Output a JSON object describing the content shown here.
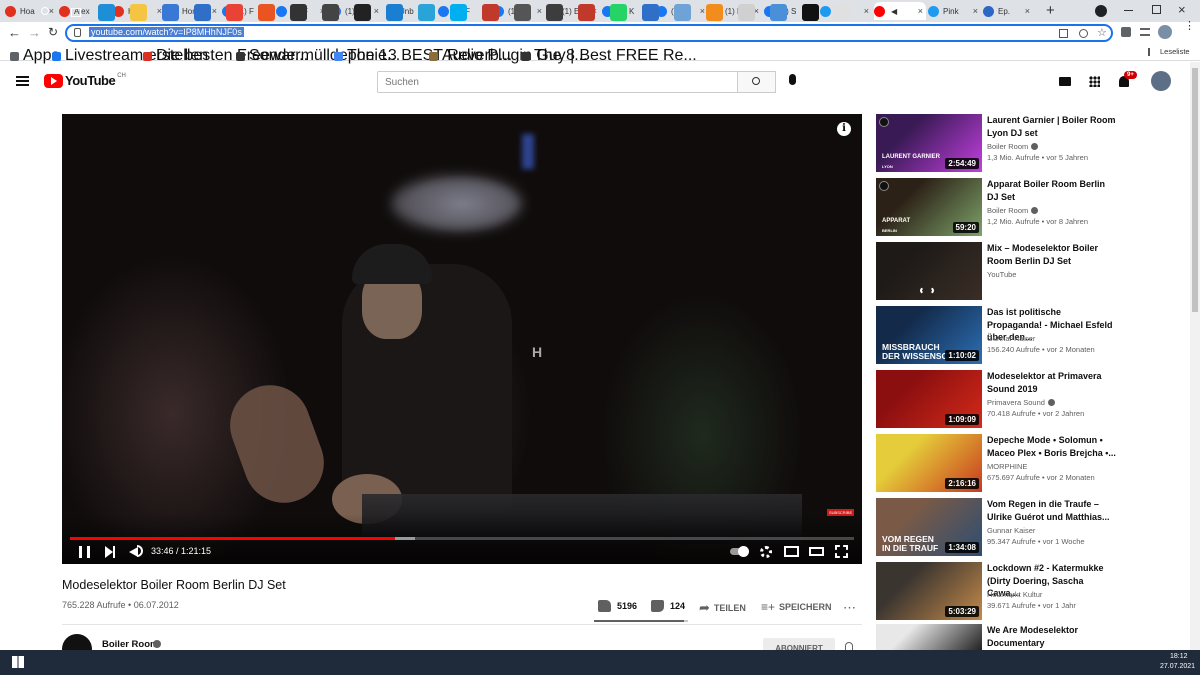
{
  "browser": {
    "tabs": [
      {
        "label": "Hoa",
        "icon": "opera-icon",
        "color": "#e0301e"
      },
      {
        "label": "Alex",
        "icon": "opera-icon",
        "color": "#e0301e"
      },
      {
        "label": "Hoa",
        "icon": "opera-icon",
        "color": "#e0301e"
      },
      {
        "label": "Hon",
        "icon": "twitter-icon",
        "color": "#1d9bf0"
      },
      {
        "label": "(1) F",
        "icon": "facebook-icon",
        "color": "#1877f2"
      },
      {
        "label": "(1) F",
        "icon": "facebook-icon",
        "color": "#1877f2"
      },
      {
        "label": "(1) F",
        "icon": "facebook-icon",
        "color": "#1877f2"
      },
      {
        "label": "Unb",
        "icon": "blank-icon",
        "color": "#dee1e6"
      },
      {
        "label": "(1) F",
        "icon": "facebook-icon",
        "color": "#1877f2"
      },
      {
        "label": "(1) n",
        "icon": "facebook-icon",
        "color": "#1877f2"
      },
      {
        "label": "(1) E",
        "icon": "facebook-icon",
        "color": "#1877f2"
      },
      {
        "label": "(1) K",
        "icon": "facebook-icon",
        "color": "#1877f2"
      },
      {
        "label": "(1) a",
        "icon": "facebook-icon",
        "color": "#1877f2"
      },
      {
        "label": "(1) F",
        "icon": "facebook-icon",
        "color": "#1877f2"
      },
      {
        "label": "(1) S",
        "icon": "facebook-icon",
        "color": "#1877f2"
      },
      {
        "label": "Hon",
        "icon": "twitter-icon",
        "color": "#1d9bf0"
      },
      {
        "label": "",
        "icon": "youtube-icon",
        "color": "#ff0000"
      },
      {
        "label": "Pink",
        "icon": "twitter-icon",
        "color": "#1d9bf0"
      },
      {
        "label": "Ep.",
        "icon": "s-icon",
        "color": "#2d66c3"
      }
    ],
    "url": "youtube.com/watch?v=IP8MHhNJF0s",
    "reading_list": "Leseliste",
    "bookmarks": [
      {
        "label": "Apps",
        "color": "#5f6368"
      },
      {
        "label": "Livestream erstellen",
        "color": "#1877f2"
      },
      {
        "label": "Die besten Freewar...",
        "color": "#d93025"
      },
      {
        "label": "Sondermülldeponie...",
        "color": "#333333"
      },
      {
        "label": "The 13 BEST Reverb...",
        "color": "#4285f4"
      },
      {
        "label": "Audio Plugin Guy |...",
        "color": "#8a6d3b"
      },
      {
        "label": "The 8 Best FREE Re...",
        "color": "#333333"
      }
    ]
  },
  "youtube": {
    "logo_text": "YouTube",
    "region": "CH",
    "search_placeholder": "Suchen",
    "notification_count": "9+",
    "player": {
      "current_time": "33:46 / 1:21:15",
      "progress": 0.415,
      "buffered": 0.44,
      "badge": "SUBSCRIBE",
      "overlay_letter": "H"
    },
    "video": {
      "title": "Modeselektor Boiler Room Berlin DJ Set",
      "views_date": "765.228 Aufrufe • 06.07.2012",
      "likes": "5196",
      "dislikes": "124",
      "share": "TEILEN",
      "save": "SPEICHERN",
      "channel": "Boiler Room",
      "subscribe": "ABONNIERT"
    },
    "suggestions": [
      {
        "title": "Laurent Garnier | Boiler Room Lyon DJ set",
        "channel": "Boiler Room",
        "verified": true,
        "meta": "1,3 Mio. Aufrufe • vor 5 Jahren",
        "duration": "2:54:49",
        "thumb_text": "LAURENT GARNIER",
        "thumb_sub": "LYON",
        "thumb_bg": "#3a1a55",
        "thumb_accent": "#c23fe0"
      },
      {
        "title": "Apparat Boiler Room Berlin DJ Set",
        "channel": "Boiler Room",
        "verified": true,
        "meta": "1,2 Mio. Aufrufe • vor 8 Jahren",
        "duration": "59:20",
        "thumb_text": "APPARAT",
        "thumb_sub": "BERLIN",
        "thumb_bg": "#2c2116",
        "thumb_accent": "#7da36a"
      },
      {
        "title": "Mix – Modeselektor Boiler Room Berlin DJ Set",
        "channel": "YouTube",
        "verified": false,
        "meta": "",
        "duration": "",
        "thumb_text": "",
        "thumb_sub": "",
        "thumb_bg": "#1e1a18",
        "thumb_accent": "#3a2e26"
      },
      {
        "title": "Das ist politische Propaganda! - Michael Esfeld über den...",
        "channel": "Gunnar Kaiser",
        "verified": false,
        "meta": "156.240 Aufrufe • vor 2 Monaten",
        "duration": "1:10:02",
        "thumb_text": "MISSBRAUCH",
        "thumb_sub": "DER WISSENSC",
        "thumb_bg": "#132a4a",
        "thumb_accent": "#2c6fb5"
      },
      {
        "title": "Modeselektor at Primavera Sound 2019",
        "channel": "Primavera Sound",
        "verified": true,
        "meta": "70.418 Aufrufe • vor 2 Jahren",
        "duration": "1:09:09",
        "thumb_text": "",
        "thumb_sub": "",
        "thumb_bg": "#8c0f0f",
        "thumb_accent": "#d42a1a"
      },
      {
        "title": "Depeche Mode • Solomun • Maceo Plex • Boris Brejcha •...",
        "channel": "MORPHINE",
        "verified": false,
        "meta": "675.697 Aufrufe • vor 2 Monaten",
        "duration": "2:16:16",
        "thumb_text": "",
        "thumb_sub": "",
        "thumb_bg": "#e5cc3a",
        "thumb_accent": "#c83a1e"
      },
      {
        "title": "Vom Regen in die Traufe – Ulrike Guérot und Matthias...",
        "channel": "Gunnar Kaiser",
        "verified": false,
        "meta": "95.347 Aufrufe • vor 1 Woche",
        "duration": "1:34:08",
        "thumb_text": "VOM REGEN",
        "thumb_sub": "IN DIE TRAUF",
        "thumb_bg": "#7a5a46",
        "thumb_accent": "#2d4e73"
      },
      {
        "title": "Lockdown #2 - Katermukke (Dirty Doering, Sascha Cawa,...",
        "channel": "Holzmarkt Kultur",
        "verified": false,
        "meta": "39.671 Aufrufe • vor 1 Jahr",
        "duration": "5:03:29",
        "thumb_text": "",
        "thumb_sub": "",
        "thumb_bg": "#3b3530",
        "thumb_accent": "#c48a4a"
      },
      {
        "title": "We Are Modeselektor Documentary",
        "channel": "",
        "verified": false,
        "meta": "",
        "duration": "",
        "thumb_text": "",
        "thumb_sub": "",
        "thumb_bg": "#e8e8e8",
        "thumb_accent": "#222222"
      }
    ]
  },
  "taskbar": {
    "time": "18:12",
    "date": "27.07.2021",
    "apps": [
      {
        "name": "search-icon",
        "color": "#1f2a3a"
      },
      {
        "name": "task-view-icon",
        "color": "#1f2a3a"
      },
      {
        "name": "edge-icon",
        "color": "#1e8fd6"
      },
      {
        "name": "file-explorer-icon",
        "color": "#f4c542"
      },
      {
        "name": "store-icon",
        "color": "#3a78d6"
      },
      {
        "name": "mail-icon",
        "color": "#2f6fc8"
      },
      {
        "name": "chrome-icon",
        "color": "#e94335"
      },
      {
        "name": "ubuntu-icon",
        "color": "#e95420"
      },
      {
        "name": "app-icon",
        "color": "#333333"
      },
      {
        "name": "inkscape-icon",
        "color": "#444444"
      },
      {
        "name": "ableton-live-icon",
        "color": "#222222"
      },
      {
        "name": "cloud-app-icon",
        "color": "#1a7fd0"
      },
      {
        "name": "telegram-icon",
        "color": "#2aa3d8"
      },
      {
        "name": "skype-icon",
        "color": "#00aff0"
      },
      {
        "name": "media-app-icon",
        "color": "#c0392b"
      },
      {
        "name": "keyboard-icon",
        "color": "#555555"
      },
      {
        "name": "tool-icon",
        "color": "#3d3d3d"
      },
      {
        "name": "cubase-icon",
        "color": "#c0392b"
      },
      {
        "name": "whatsapp-icon",
        "color": "#25d366"
      },
      {
        "name": "app-blue-icon",
        "color": "#2f6fc8"
      },
      {
        "name": "editor-icon",
        "color": "#6fa3d8"
      },
      {
        "name": "vlc-icon",
        "color": "#f28c1c"
      },
      {
        "name": "film-icon",
        "color": "#d0d0d0"
      },
      {
        "name": "photos-icon",
        "color": "#4a90d9"
      },
      {
        "name": "terminal-icon",
        "color": "#111111"
      },
      {
        "name": "notes-icon",
        "color": "#e0e0e0"
      }
    ]
  }
}
